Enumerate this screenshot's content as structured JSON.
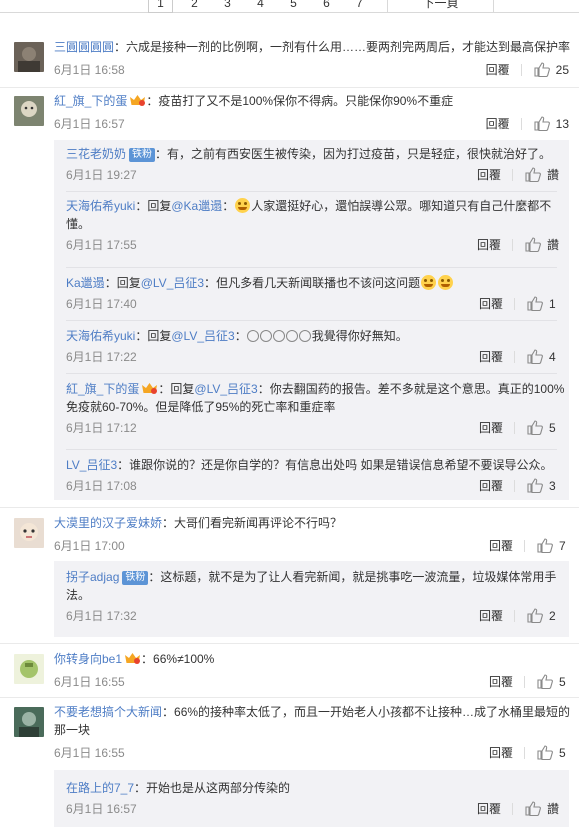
{
  "pager": {
    "pages": [
      "1",
      "2",
      "3",
      "4",
      "5",
      "6",
      "7"
    ],
    "active_page": "1",
    "next_label": "下一頁"
  },
  "labels": {
    "reply": "回覆",
    "colon": "：",
    "reply_to_prefix": "回复",
    "iron_fan_badge": "铁粉"
  },
  "comments": [
    {
      "user": "三圓圓圓圓",
      "text": "六成是接种一剂的比例啊，一剂有什么用……要两剂完两周后，才能达到最高保护率",
      "time": "6月1日 16:58",
      "likes": "25",
      "avatar_color": "#5a5148"
    },
    {
      "user": "紅_旗_下的蛋",
      "text": "疫苗打了又不是100%保你不得病。只能保你90%不重症",
      "time": "6月1日 16:57",
      "likes": "13",
      "avatar_color": "#6f7560",
      "replies": [
        {
          "user": "三花老奶奶",
          "text": "有，之前有西安医生被传染，因为打过疫苗，只是轻症，很快就治好了。",
          "time": "6月1日 19:27",
          "likes": "讚"
        },
        {
          "user": "天海佑希yuki",
          "reply_to": "@Ka邋遢",
          "text_a": "人家還挺好心，還怕誤導公眾。哪知道只有自己什麼都不",
          "text_b": "懂。",
          "time": "6月1日 17:55",
          "likes": "讚"
        },
        {
          "user": "Ka邋遢",
          "reply_to": "@LV_吕征3",
          "text": "但凡多看几天新闻联播也不该问这问题",
          "time": "6月1日 17:40",
          "likes": "1"
        },
        {
          "user": "天海佑希yuki",
          "reply_to": "@LV_吕征3",
          "text": "我覺得你好無知。",
          "time": "6月1日 17:22",
          "likes": "4"
        },
        {
          "user": "紅_旗_下的蛋",
          "reply_to": "@LV_吕征3",
          "text_a": "你去翻国药的报告。差不多就是这个意思。真正的100%",
          "text_b": "免疫就60-70%。但是降低了95%的死亡率和重症率",
          "time": "6月1日 17:12",
          "likes": "5"
        },
        {
          "user": "LV_吕征3",
          "text": "谁跟你说的？还是你自学的？有信息出处吗 如果是错误信息希望不要误导公众。",
          "time": "6月1日 17:08",
          "likes": "3"
        }
      ]
    },
    {
      "user": "大漠里的汉子爱妹娇",
      "text": "大哥们看完新闻再评论不行吗？",
      "time": "6月1日 17:00",
      "likes": "7",
      "avatar_color": "#c9b7a6",
      "replies": [
        {
          "user": "拐子adjag",
          "text_a": "这标题，就不是为了让人看完新闻，就是挑事吃一波流量，垃圾媒体常用手",
          "text_b": "法。",
          "time": "6月1日 17:32",
          "likes": "2"
        }
      ]
    },
    {
      "user": "你转身向be1",
      "text": "66%≠100%",
      "time": "6月1日 16:55",
      "likes": "5",
      "avatar_color": "#9fb96b"
    },
    {
      "user": "不要老想搞个大新闻",
      "text_a": "66%的接种率太低了，而且一开始老人小孩都不让接种…成了水桶里最短的",
      "text_b": "那一块",
      "time": "6月1日 16:55",
      "likes": "5",
      "avatar_color": "#3d5a4b",
      "replies": [
        {
          "user": "在路上的7_7",
          "text": "开始也是从这两部分传染的",
          "time": "6月1日 16:57",
          "likes": "讚"
        }
      ]
    }
  ]
}
